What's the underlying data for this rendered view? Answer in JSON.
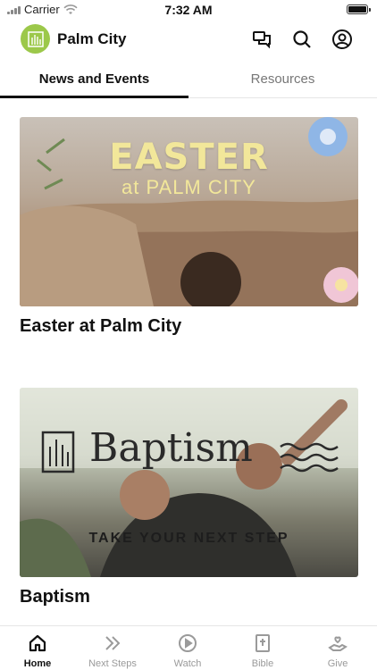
{
  "status_bar": {
    "carrier": "Carrier",
    "time": "7:32 AM"
  },
  "header": {
    "title": "Palm City",
    "icons": [
      "chat-icon",
      "search-icon",
      "profile-icon"
    ]
  },
  "tabs": [
    {
      "label": "News and Events",
      "active": true
    },
    {
      "label": "Resources",
      "active": false
    }
  ],
  "cards": [
    {
      "title": "Easter at Palm City",
      "image": {
        "headline": "EASTER",
        "subline": "at PALM CITY"
      }
    },
    {
      "title": "Baptism",
      "image": {
        "headline": "Baptism",
        "tagline": "TAKE YOUR NEXT STEP"
      }
    }
  ],
  "bottom_nav": [
    {
      "label": "Home",
      "icon": "home-icon",
      "active": true
    },
    {
      "label": "Next Steps",
      "icon": "chevrons-icon",
      "active": false
    },
    {
      "label": "Watch",
      "icon": "play-icon",
      "active": false
    },
    {
      "label": "Bible",
      "icon": "bible-icon",
      "active": false
    },
    {
      "label": "Give",
      "icon": "give-icon",
      "active": false
    }
  ],
  "colors": {
    "accent": "#111111",
    "logo": "#9cc84a",
    "inactive": "#9a9a9a"
  }
}
